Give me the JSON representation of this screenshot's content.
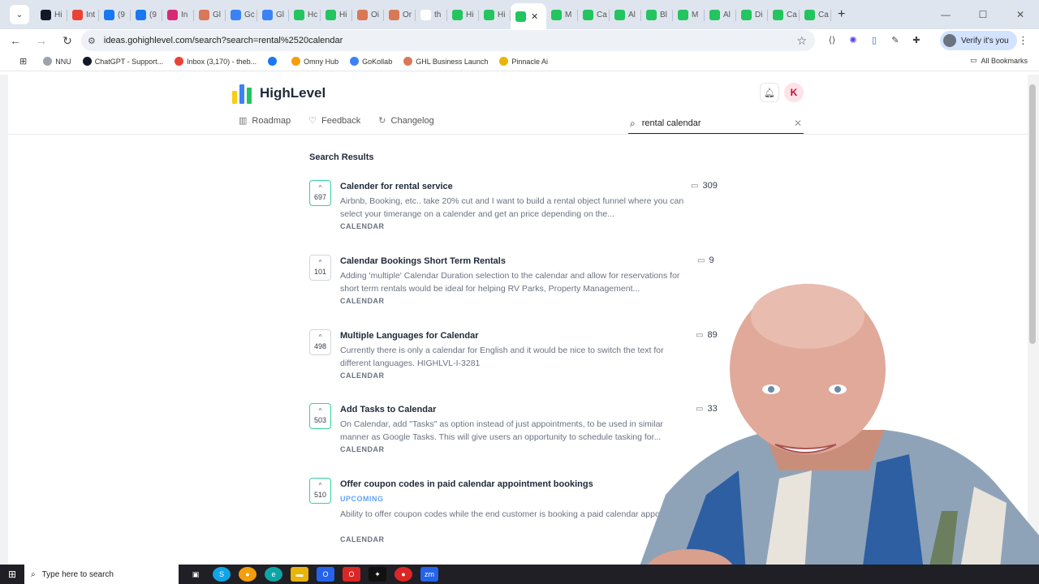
{
  "browser": {
    "tabs": [
      {
        "label": "Hi",
        "fav": "#111827"
      },
      {
        "label": "Int",
        "fav": "#ea4335"
      },
      {
        "label": "(9",
        "fav": "#1877f2"
      },
      {
        "label": "(9",
        "fav": "#1877f2"
      },
      {
        "label": "In",
        "fav": "#d62976"
      },
      {
        "label": "Gl",
        "fav": "#d97757"
      },
      {
        "label": "Gc",
        "fav": "#3b82f6"
      },
      {
        "label": "Gl",
        "fav": "#3b82f6"
      },
      {
        "label": "Hc",
        "fav": "#22c55e"
      },
      {
        "label": "Hi",
        "fav": "#22c55e"
      },
      {
        "label": "Oi",
        "fav": "#d97757"
      },
      {
        "label": "Or",
        "fav": "#d97757"
      },
      {
        "label": "th",
        "fav": "#ffffff"
      },
      {
        "label": "Hi",
        "fav": "#22c55e"
      },
      {
        "label": "Hi",
        "fav": "#22c55e"
      }
    ],
    "tabs_after": [
      {
        "label": "M",
        "fav": "#22c55e"
      },
      {
        "label": "Ca",
        "fav": "#22c55e"
      },
      {
        "label": "Al",
        "fav": "#22c55e"
      },
      {
        "label": "Bl",
        "fav": "#22c55e"
      },
      {
        "label": "M",
        "fav": "#22c55e"
      },
      {
        "label": "Al",
        "fav": "#22c55e"
      },
      {
        "label": "Di",
        "fav": "#22c55e"
      },
      {
        "label": "Ca",
        "fav": "#22c55e"
      },
      {
        "label": "Ca",
        "fav": "#22c55e"
      }
    ],
    "url": "ideas.gohighlevel.com/search?search=rental%2520calendar",
    "verify_label": "Verify it's you",
    "bookmarks": [
      {
        "label": "NNU",
        "color": "#9ca3af"
      },
      {
        "label": "ChatGPT - Support...",
        "color": "#111827"
      },
      {
        "label": "Inbox (3,170) - theb...",
        "color": "#ea4335"
      },
      {
        "label": "",
        "color": "#1877f2"
      },
      {
        "label": "Omny Hub",
        "color": "#f59e0b"
      },
      {
        "label": "GoKollab",
        "color": "#3b82f6"
      },
      {
        "label": "GHL Business Launch",
        "color": "#d97757"
      },
      {
        "label": "Pinnacle Ai",
        "color": "#eab308"
      }
    ],
    "all_bookmarks": "All Bookmarks"
  },
  "app": {
    "brand": "HighLevel",
    "avatar_initial": "K",
    "nav": [
      {
        "label": "Roadmap",
        "icon": "map-icon"
      },
      {
        "label": "Feedback",
        "icon": "lightbulb-icon"
      },
      {
        "label": "Changelog",
        "icon": "refresh-icon"
      }
    ],
    "search": {
      "value": "rental calendar"
    },
    "results_title": "Search Results"
  },
  "results": [
    {
      "votes": "697",
      "voted": true,
      "title": "Calender for rental service",
      "desc": "Airbnb, Booking, etc.. take 20% cut and I want to build a rental object funnel where you can select your timerange on a calender and get an price depending on the...",
      "status": "",
      "category": "CALENDAR",
      "comments": "309"
    },
    {
      "votes": "101",
      "voted": false,
      "title": "Calendar Bookings Short Term Rentals",
      "desc": "Adding 'multiple' Calendar Duration selection to the calendar and allow for reservations for short term rentals would be ideal for helping RV Parks, Property Management...",
      "status": "",
      "category": "CALENDAR",
      "comments": "9"
    },
    {
      "votes": "498",
      "voted": false,
      "title": "Multiple Languages for Calendar",
      "desc": "Currently there is only a calendar for English and it would be nice to switch the text for different languages. HIGHLVL-I-3281",
      "status": "",
      "category": "CALENDAR",
      "comments": "89"
    },
    {
      "votes": "503",
      "voted": true,
      "title": "Add Tasks to Calendar",
      "desc": "On Calendar, add \"Tasks\" as option instead of just appointments, to be used in similar manner as Google Tasks. This will give users an opportunity to schedule tasking for...",
      "status": "",
      "category": "CALENDAR",
      "comments": "33"
    },
    {
      "votes": "510",
      "voted": true,
      "title": "Offer coupon codes in paid calendar appointment bookings",
      "desc": "Ability to offer coupon codes while the end customer is booking a paid calendar appointment",
      "status": "UPCOMING",
      "category": "CALENDAR",
      "comments": ""
    }
  ],
  "taskbar": {
    "search_placeholder": "Type here to search"
  }
}
